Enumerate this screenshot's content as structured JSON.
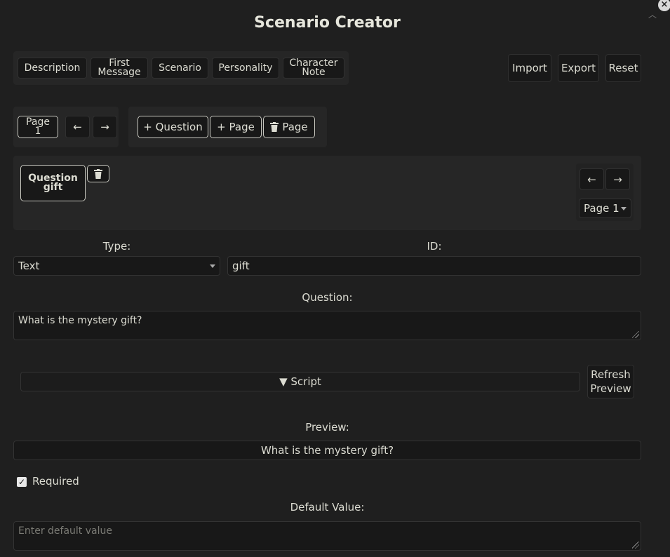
{
  "app": {
    "title": "Scenario Creator"
  },
  "tabs": [
    {
      "label": "Description"
    },
    {
      "label": "First Message"
    },
    {
      "label": "Scenario"
    },
    {
      "label": "Personality"
    },
    {
      "label": "Character Note"
    }
  ],
  "actions": {
    "import": "Import",
    "export": "Export",
    "reset": "Reset"
  },
  "pagebar": {
    "current_page": "Page 1",
    "prev_icon": "arrow-left-icon",
    "next_icon": "arrow-right-icon",
    "add_question": "+ Question",
    "add_page": "+ Page",
    "delete_page": "Page"
  },
  "question_card": {
    "label": "Question gift",
    "page_select": "Page 1"
  },
  "form": {
    "type_label": "Type:",
    "type_value": "Text",
    "id_label": "ID:",
    "id_value": "gift",
    "question_label": "Question:",
    "question_value": "What is the mystery gift?",
    "script_label": "▼ Script",
    "refresh_preview": "Refresh Preview",
    "preview_label": "Preview:",
    "preview_value": "What is the mystery gift?",
    "required_label": "Required",
    "required_checked": true,
    "default_label": "Default Value:",
    "default_placeholder": "Enter default value"
  }
}
